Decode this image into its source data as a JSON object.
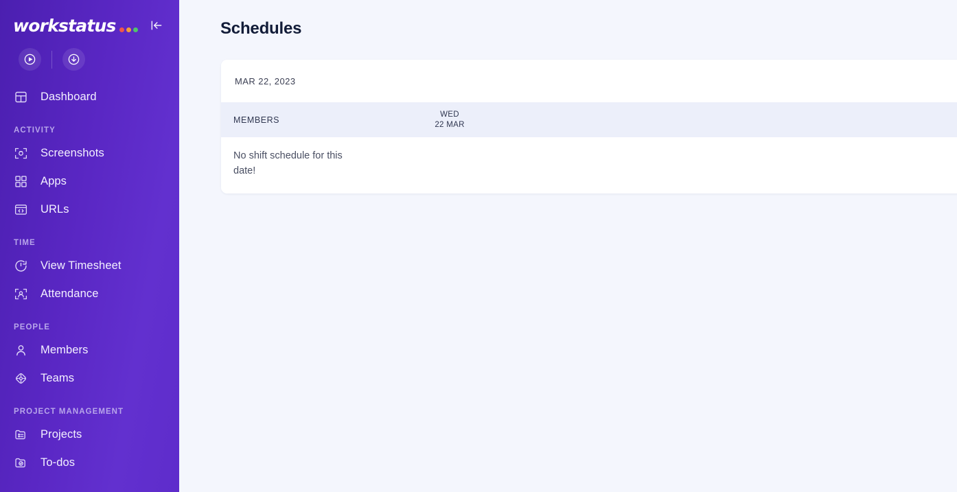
{
  "sidebar": {
    "logo": {
      "text": "workstatus",
      "dots": [
        "#f0564a",
        "#f39c3a",
        "#4fc36b"
      ]
    },
    "collapse_icon": "collapse-sidebar-icon",
    "quick_actions": [
      {
        "name": "start-timer-button",
        "icon": "play-circle-icon"
      },
      {
        "name": "download-button",
        "icon": "download-circle-icon"
      }
    ],
    "groups": [
      {
        "section": null,
        "items": [
          {
            "label": "Dashboard",
            "icon": "layout-dashboard-icon",
            "key": "dashboard"
          }
        ]
      },
      {
        "section": "ACTIVITY",
        "items": [
          {
            "label": "Screenshots",
            "icon": "screenshot-icon",
            "key": "screenshots"
          },
          {
            "label": "Apps",
            "icon": "grid-apps-icon",
            "key": "apps"
          },
          {
            "label": "URLs",
            "icon": "browser-code-icon",
            "key": "urls"
          }
        ]
      },
      {
        "section": "TIME",
        "items": [
          {
            "label": "View Timesheet",
            "icon": "timer-icon",
            "key": "view-timesheet"
          },
          {
            "label": "Attendance",
            "icon": "face-scan-icon",
            "key": "attendance"
          }
        ]
      },
      {
        "section": "PEOPLE",
        "items": [
          {
            "label": "Members",
            "icon": "user-icon",
            "key": "members"
          },
          {
            "label": "Teams",
            "icon": "teams-node-icon",
            "key": "teams"
          }
        ]
      },
      {
        "section": "PROJECT MANAGEMENT",
        "items": [
          {
            "label": "Projects",
            "icon": "folder-list-icon",
            "key": "projects"
          },
          {
            "label": "To-dos",
            "icon": "folder-check-icon",
            "key": "to-dos"
          }
        ]
      }
    ]
  },
  "main": {
    "page_title": "Schedules",
    "card": {
      "date_label": "MAR 22, 2023",
      "table": {
        "members_header": "MEMBERS",
        "columns": [
          {
            "weekday": "WED",
            "date": "22 MAR"
          }
        ],
        "empty_message": "No shift schedule for this date!"
      }
    }
  },
  "colors": {
    "sidebar_start": "#4b1fb0",
    "sidebar_end": "#5e2ccb",
    "page_background": "#f4f6fd",
    "card_background": "#ffffff",
    "table_header_background": "#eceffa",
    "title_text": "#121c38"
  }
}
